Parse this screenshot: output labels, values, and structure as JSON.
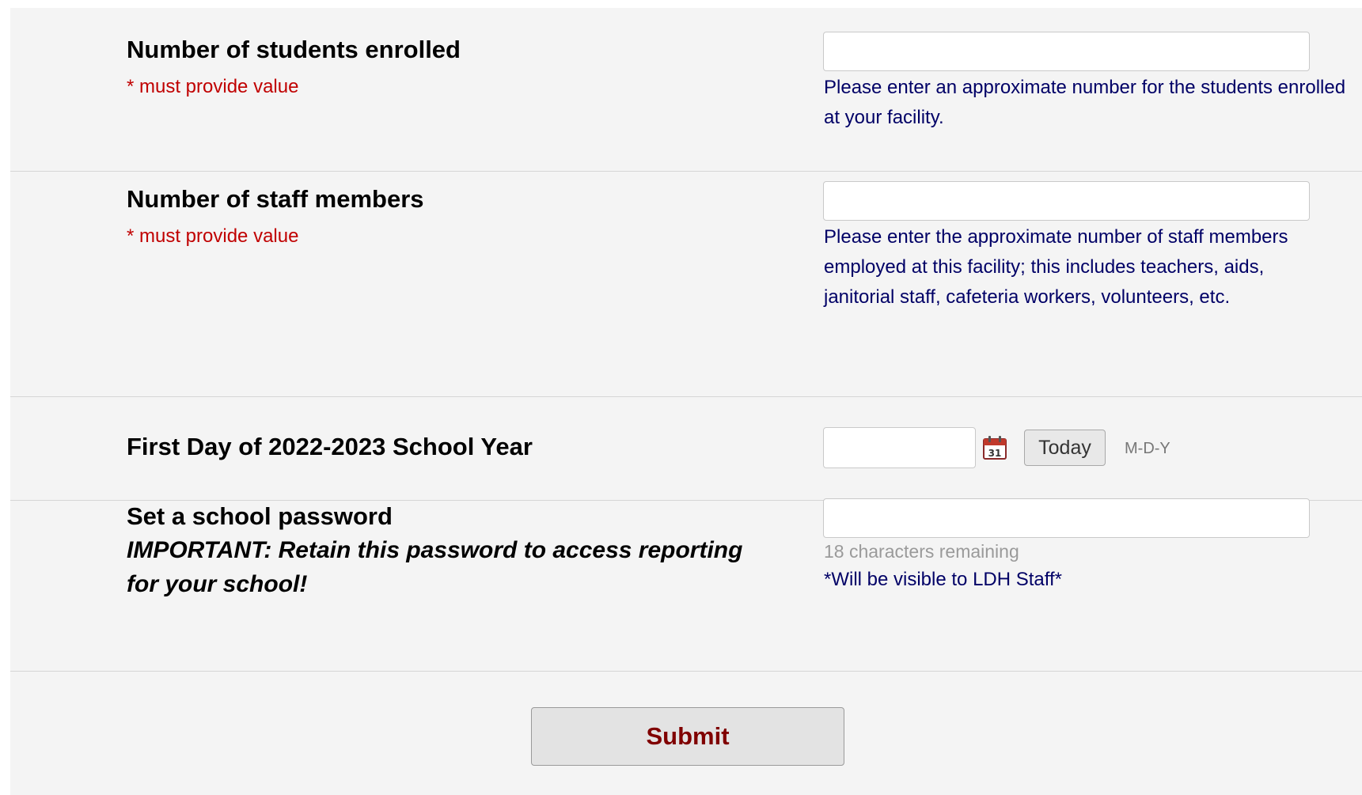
{
  "form": {
    "fields": [
      {
        "label": "Number of students enrolled",
        "required_text": "* must provide value",
        "value": "",
        "help": "Please enter an approximate number for the students enrolled at your facility."
      },
      {
        "label": "Number of staff members",
        "required_text": "* must provide value",
        "value": "",
        "help": "Please enter the approximate number of staff members employed at this facility; this includes teachers, aids, janitorial staff, cafeteria workers, volunteers, etc."
      },
      {
        "label": "First Day of 2022-2023 School Year",
        "value": "",
        "today_button": "Today",
        "date_format": "M-D-Y",
        "icon": "calendar-icon"
      },
      {
        "label": "Set a school password",
        "note": "IMPORTANT: Retain this password to access reporting for your school!",
        "value": "",
        "counter": "18 characters remaining",
        "visibility_note": "*Will be visible to LDH Staff*"
      }
    ],
    "submit_label": "Submit"
  },
  "colors": {
    "required": "#c00000",
    "help_text": "#000066",
    "submit_text": "#800000",
    "background": "#f4f4f4"
  }
}
